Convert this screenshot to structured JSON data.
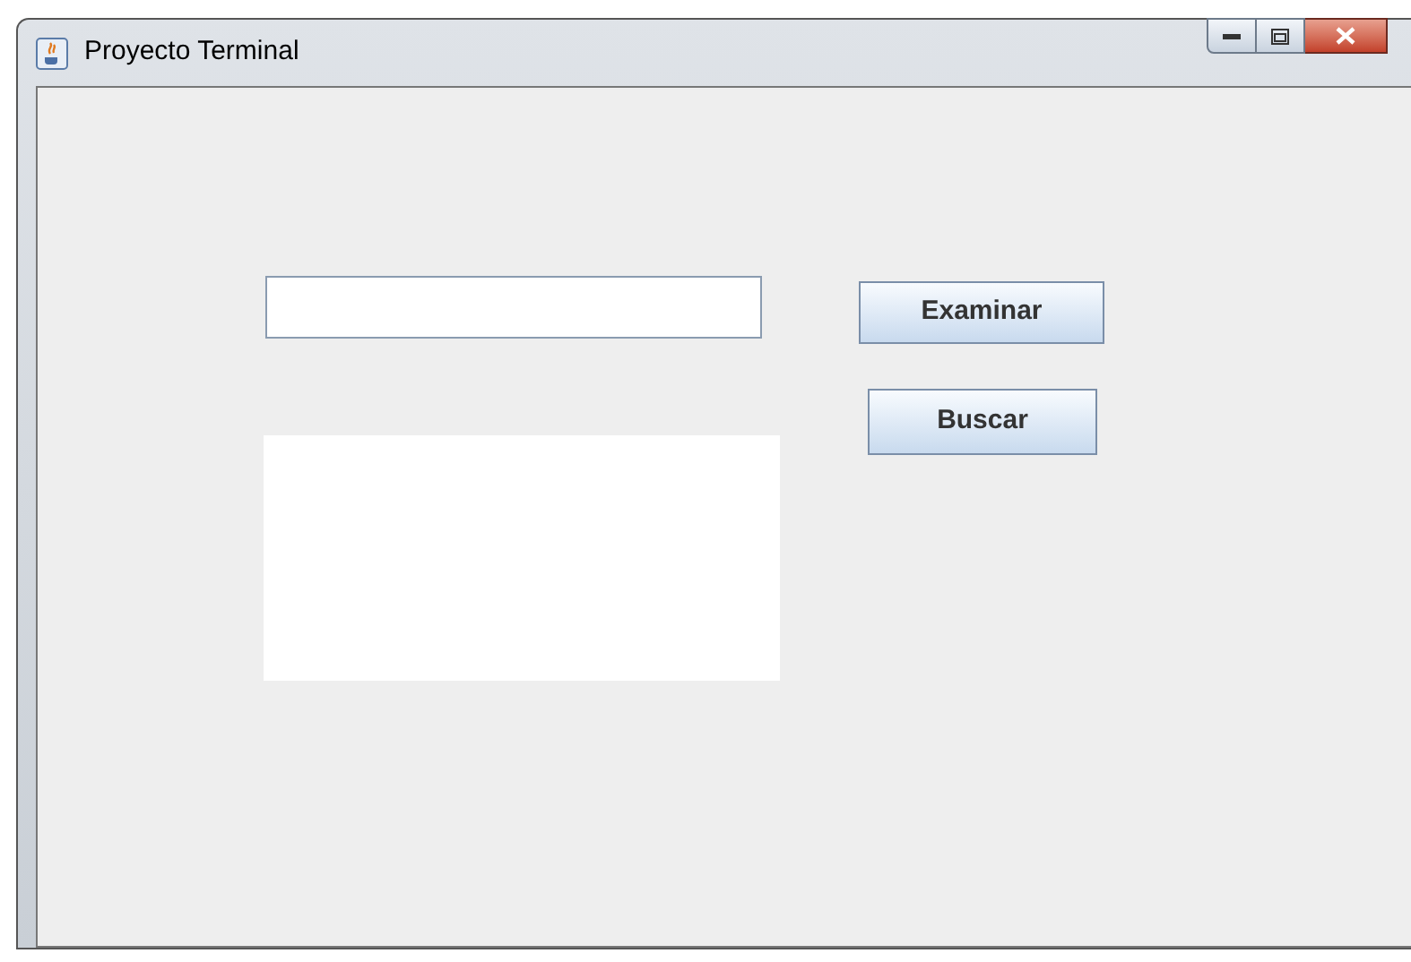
{
  "window": {
    "title": "Proyecto Terminal"
  },
  "buttons": [
    {
      "label": "Examinar"
    },
    {
      "label": "Buscar"
    }
  ]
}
